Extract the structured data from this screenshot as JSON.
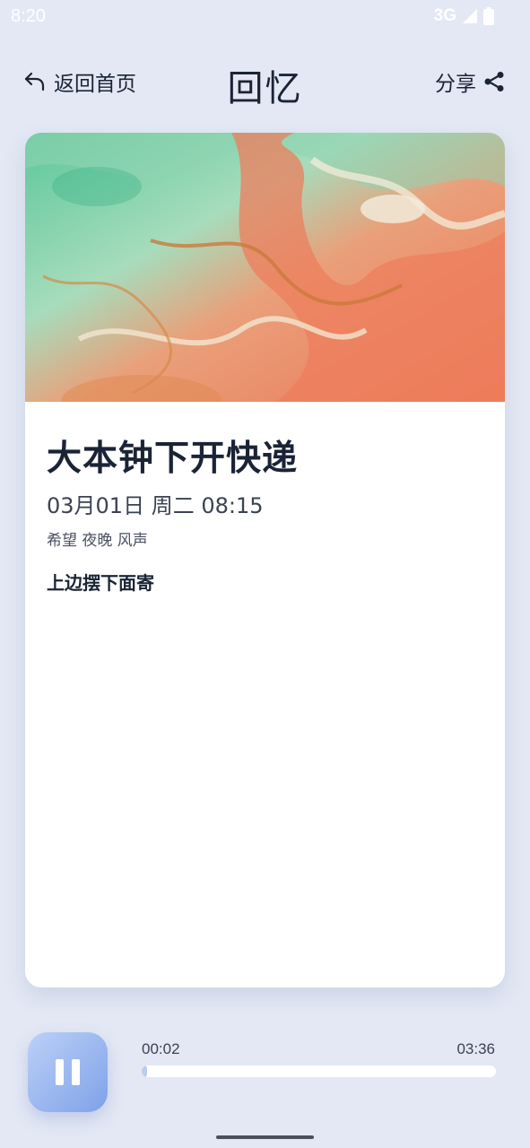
{
  "status_bar": {
    "time": "8:20",
    "network": "3G",
    "icons": [
      "signal-icon",
      "battery-icon"
    ]
  },
  "header": {
    "back_label": "返回首页",
    "back_icon": "back-arrow-icon",
    "title": "回忆",
    "share_label": "分享",
    "share_icon": "share-icon"
  },
  "memory": {
    "cover_image": "abstract-marble-art",
    "title": "大本钟下开快递",
    "date": "03月01日 周二 08:15",
    "tags": "希望 夜晚 风声",
    "content": "上边摆下面寄"
  },
  "player": {
    "state_icon": "pause-icon",
    "current_time": "00:02",
    "total_time": "03:36",
    "progress": 0.01
  },
  "colors": {
    "background": "#e3e8f4",
    "card": "#ffffff",
    "text_primary": "#1b2436",
    "accent": "#7ea2e8",
    "progress_fill": "#b9cdf5"
  }
}
